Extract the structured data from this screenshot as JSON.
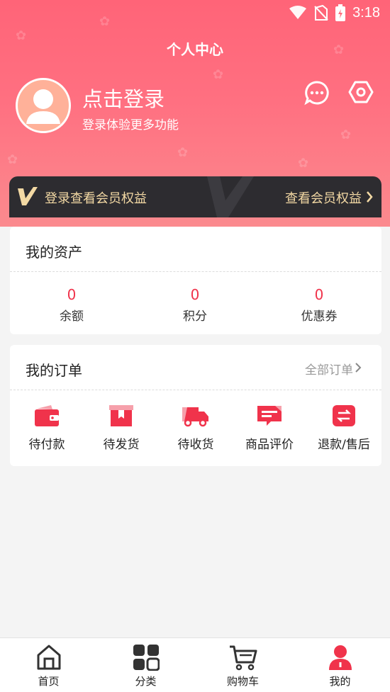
{
  "status_bar": {
    "time": "3:18"
  },
  "header": {
    "title": "个人中心",
    "login_title": "点击登录",
    "login_subtitle": "登录体验更多功能"
  },
  "vip": {
    "text": "登录查看会员权益",
    "link_label": "查看会员权益"
  },
  "assets": {
    "title": "我的资产",
    "items": [
      {
        "value": "0",
        "label": "余额"
      },
      {
        "value": "0",
        "label": "积分"
      },
      {
        "value": "0",
        "label": "优惠券"
      }
    ]
  },
  "orders": {
    "title": "我的订单",
    "all_label": "全部订单",
    "items": [
      {
        "label": "待付款",
        "icon": "wallet-icon"
      },
      {
        "label": "待发货",
        "icon": "package-icon"
      },
      {
        "label": "待收货",
        "icon": "truck-icon"
      },
      {
        "label": "商品评价",
        "icon": "review-icon"
      },
      {
        "label": "退款/售后",
        "icon": "refund-icon"
      }
    ]
  },
  "tabbar": {
    "items": [
      {
        "label": "首页",
        "icon": "home-icon"
      },
      {
        "label": "分类",
        "icon": "category-icon"
      },
      {
        "label": "购物车",
        "icon": "cart-icon"
      },
      {
        "label": "我的",
        "icon": "profile-icon",
        "active": true
      }
    ]
  },
  "colors": {
    "header_gradient_top": "#ff6478",
    "header_gradient_bottom": "#fb8a8e",
    "accent_red": "#f0334b",
    "vip_bar_bg": "#2d2c30",
    "vip_text": "#f3d9a4"
  }
}
